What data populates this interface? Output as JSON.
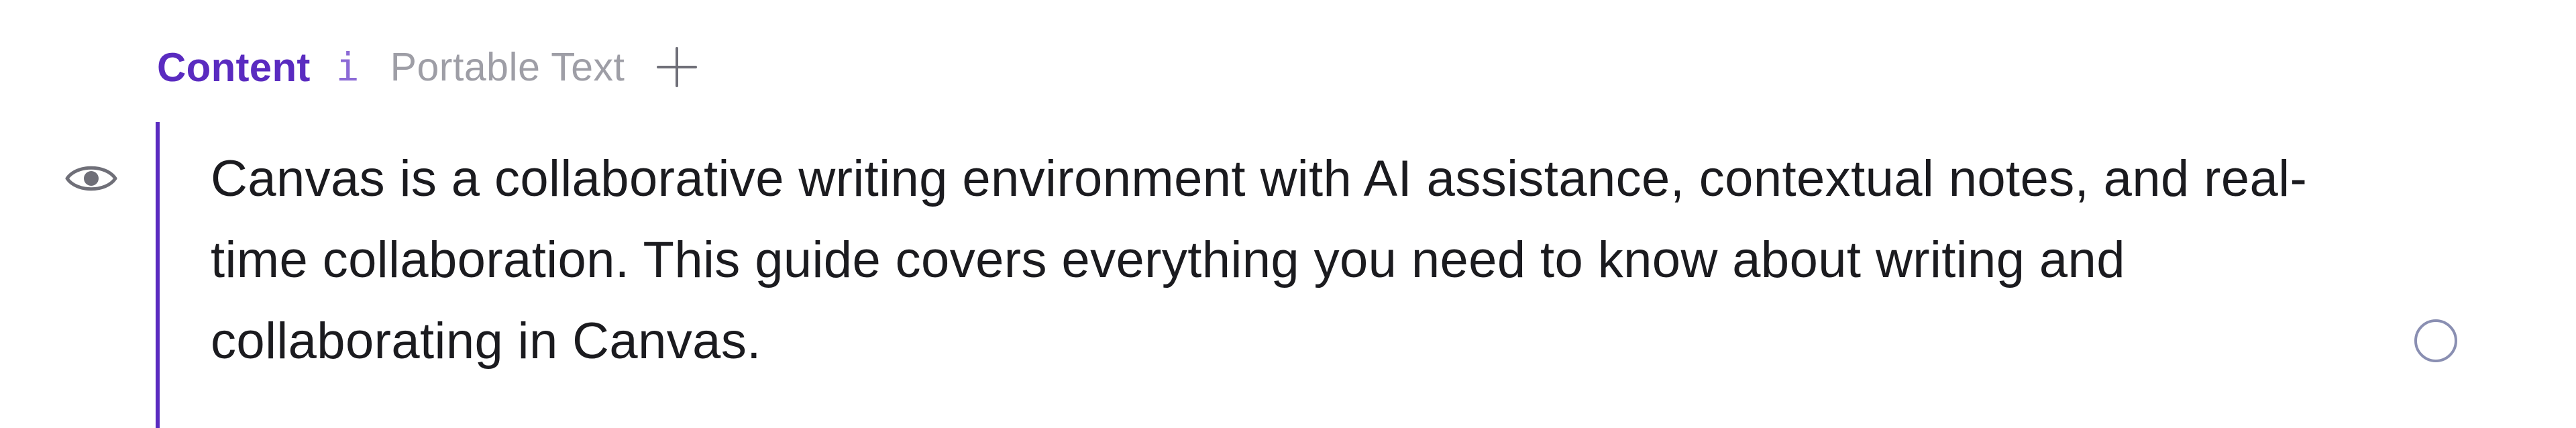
{
  "field": {
    "title": "Content",
    "info_glyph": "i",
    "type_label": "Portable Text",
    "add_icon": "plus-icon"
  },
  "block": {
    "visibility_icon": "eye-icon",
    "text": "Canvas is a collaborative writing environment with AI assistance, contextual notes, and real-time collaboration. This guide covers everything you need to know about writing and collaborating in Canvas.",
    "status_icon": "circle-icon"
  },
  "colors": {
    "accent": "#5a2bc0",
    "accent_soft": "#8c6ad6",
    "muted": "#9e9ea6",
    "icon_gray": "#6f6f78",
    "circle": "#8a8fb2"
  }
}
